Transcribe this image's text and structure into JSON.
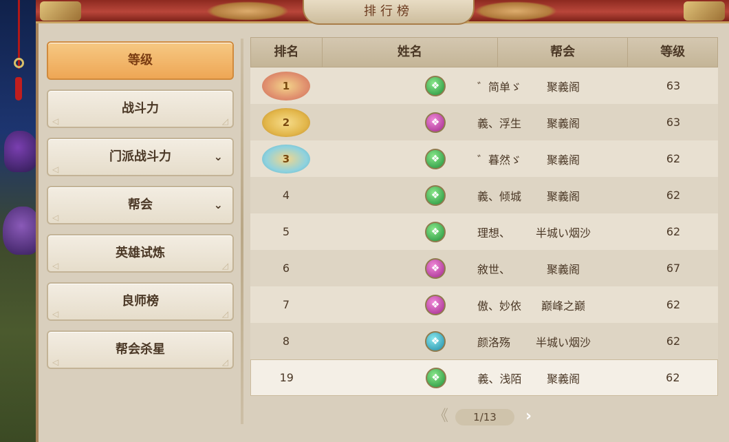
{
  "window": {
    "title": "排行榜"
  },
  "sidebar": {
    "items": [
      {
        "label": "等级",
        "active": true,
        "has_dropdown": false
      },
      {
        "label": "战斗力",
        "active": false,
        "has_dropdown": false
      },
      {
        "label": "门派战斗力",
        "active": false,
        "has_dropdown": true
      },
      {
        "label": "帮会",
        "active": false,
        "has_dropdown": true
      },
      {
        "label": "英雄试炼",
        "active": false,
        "has_dropdown": false
      },
      {
        "label": "良师榜",
        "active": false,
        "has_dropdown": false
      },
      {
        "label": "帮会杀星",
        "active": false,
        "has_dropdown": false
      }
    ]
  },
  "table": {
    "headers": [
      "排名",
      "姓名",
      "帮会",
      "等级"
    ],
    "rows": [
      {
        "rank": "1",
        "medal": "gold-red",
        "gem": "green",
        "name": "゛简单ゞ",
        "guild": "聚義阁",
        "level": "63"
      },
      {
        "rank": "2",
        "medal": "gold",
        "gem": "purple",
        "name": "義、浮生",
        "guild": "聚義阁",
        "level": "63"
      },
      {
        "rank": "3",
        "medal": "gold-teal",
        "gem": "green",
        "name": "゛暮然ゞ",
        "guild": "聚義阁",
        "level": "62"
      },
      {
        "rank": "4",
        "medal": "",
        "gem": "green",
        "name": "義、倾城",
        "guild": "聚義阁",
        "level": "62"
      },
      {
        "rank": "5",
        "medal": "",
        "gem": "green",
        "name": "理想、",
        "guild": "半城い烟沙",
        "level": "62"
      },
      {
        "rank": "6",
        "medal": "",
        "gem": "purple",
        "name": "敘世、",
        "guild": "聚義阁",
        "level": "67"
      },
      {
        "rank": "7",
        "medal": "",
        "gem": "purple",
        "name": "傲、妙依",
        "guild": "巅峰之巅",
        "level": "62"
      },
      {
        "rank": "8",
        "medal": "",
        "gem": "teal",
        "name": "颜洛殇",
        "guild": "半城い烟沙",
        "level": "62"
      },
      {
        "rank": "19",
        "medal": "",
        "gem": "green",
        "name": "義、浅陌",
        "guild": "聚義阁",
        "level": "62",
        "is_self": true
      }
    ]
  },
  "pager": {
    "text": "1/13"
  },
  "colors": {
    "accent": "#eea655",
    "panel": "#d9cfbd",
    "title_bar": "#b9463a"
  }
}
